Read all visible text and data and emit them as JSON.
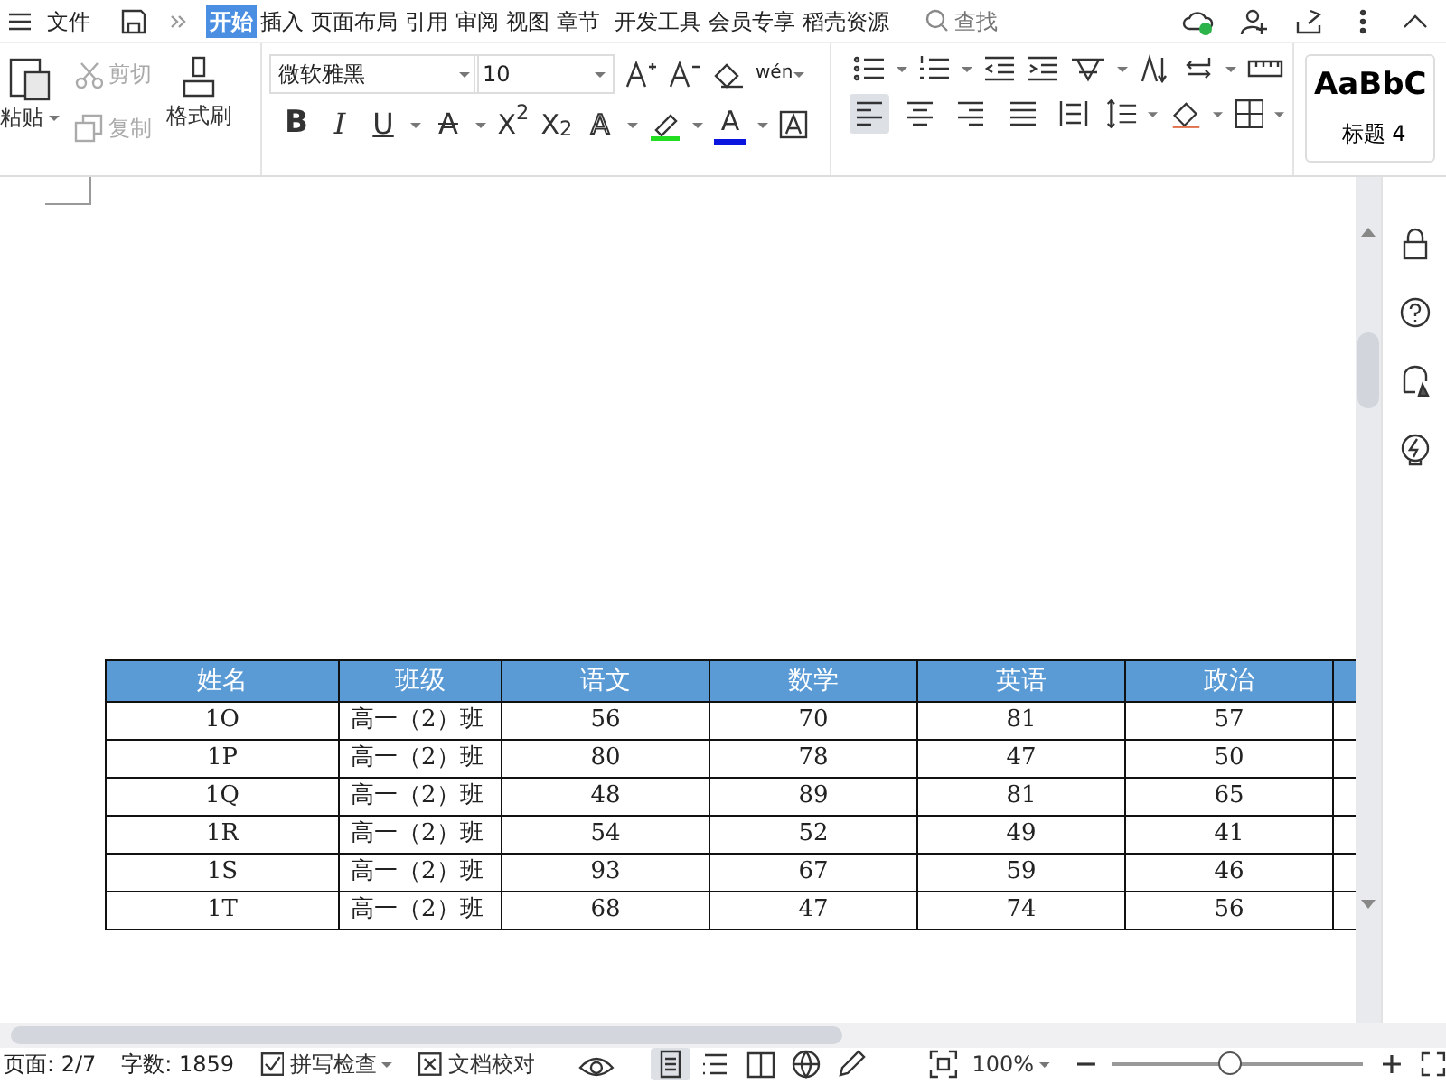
{
  "menu": {
    "file": "文件",
    "tabs": [
      {
        "label": "开始",
        "selected": true
      },
      {
        "label": "插入",
        "selected": false
      },
      {
        "label": "页面布局",
        "selected": false
      },
      {
        "label": "引用",
        "selected": false
      },
      {
        "label": "审阅",
        "selected": false
      },
      {
        "label": "视图",
        "selected": false
      },
      {
        "label": "章节",
        "selected": false
      },
      {
        "label": "开发工具",
        "selected": false
      },
      {
        "label": "会员专享",
        "selected": false
      },
      {
        "label": "稻壳资源",
        "selected": false
      }
    ],
    "search": {
      "placeholder": "查找"
    }
  },
  "clipboard": {
    "paste": "粘贴",
    "cut": {
      "label": "剪切",
      "disabled": true
    },
    "copy": {
      "label": "复制",
      "disabled": true
    },
    "painter": "格式刷"
  },
  "font": {
    "name": "微软雅黑",
    "size": "10",
    "pinyin": "wén"
  },
  "format_buttons": [
    "B",
    "I",
    "U",
    "A",
    "X$^{2}$",
    "X$_{2}$",
    "A",
    "A"
  ],
  "align_buttons": [
    {
      "kind": "left",
      "selected": true
    },
    {
      "kind": "center",
      "selected": false
    },
    {
      "kind": "right",
      "selected": false
    },
    {
      "kind": "justify",
      "selected": false
    },
    {
      "kind": "distribute",
      "selected": false
    }
  ],
  "style_preview": {
    "sample": "AaBbC",
    "name": "标题 4"
  },
  "table": {
    "columns": [
      "姓名",
      "班级",
      "语文",
      "数学",
      "英语",
      "政治"
    ],
    "rows": [
      [
        "1O",
        "高一（2）班",
        "56",
        "70",
        "81",
        "57"
      ],
      [
        "1P",
        "高一（2）班",
        "80",
        "78",
        "47",
        "50"
      ],
      [
        "1Q",
        "高一（2）班",
        "48",
        "89",
        "81",
        "65"
      ],
      [
        "1R",
        "高一（2）班",
        "54",
        "52",
        "49",
        "41"
      ],
      [
        "1S",
        "高一（2）班",
        "93",
        "67",
        "59",
        "46"
      ],
      [
        "1T",
        "高一（2）班",
        "68",
        "47",
        "74",
        "56"
      ]
    ]
  },
  "status_bar": {
    "page": "页面: 2/7",
    "words": "字数: 1859",
    "spell": "拼写检查",
    "proof": "文档校对",
    "views": [
      {
        "kind": "page",
        "selected": true
      },
      {
        "kind": "outline",
        "selected": false
      },
      {
        "kind": "read",
        "selected": false
      },
      {
        "kind": "web",
        "selected": false
      },
      {
        "kind": "write",
        "selected": false
      }
    ],
    "zoom": "100%",
    "zoom_slider": {
      "level": 0.47
    }
  }
}
